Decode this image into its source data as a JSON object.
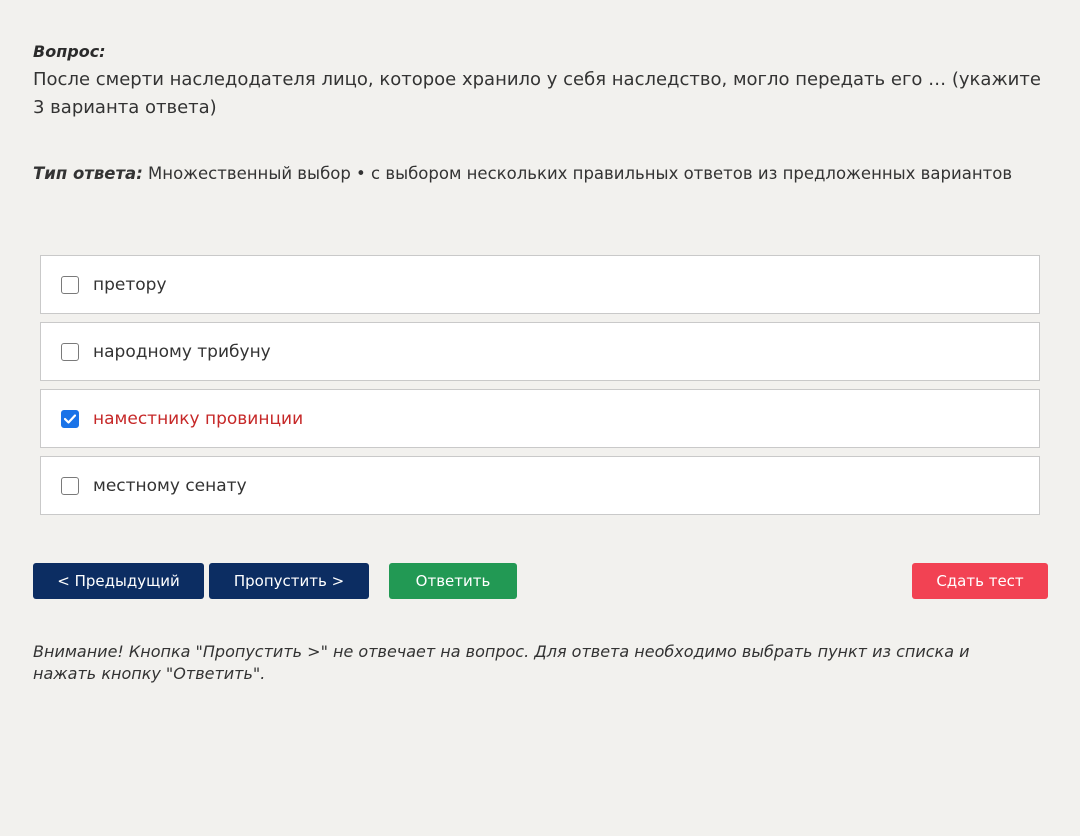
{
  "question": {
    "label": "Вопрос:",
    "text": "После смерти наследодателя лицо, которое хранило у себя наследство, могло передать его … (укажите 3 варианта ответа)"
  },
  "answer_type": {
    "label": "Тип ответа:",
    "value": "Множественный выбор • с выбором нескольких правильных ответов из предложенных вариантов"
  },
  "options": [
    {
      "label": "претору",
      "checked": false
    },
    {
      "label": "народному трибуну",
      "checked": false
    },
    {
      "label": "наместнику провинции",
      "checked": true
    },
    {
      "label": "местному сенату",
      "checked": false
    }
  ],
  "buttons": {
    "prev": "< Предыдущий",
    "skip": "Пропустить >",
    "answer": "Ответить",
    "finish": "Сдать тест"
  },
  "note": "Внимание! Кнопка \"Пропустить >\" не отвечает на вопрос. Для ответа необходимо выбрать пункт из списка и нажать кнопку \"Ответить\".",
  "colors": {
    "background": "#f2f1ee",
    "primary_button": "#0c2d62",
    "answer_button": "#229954",
    "finish_button": "#f24253",
    "selected_text": "#c62828",
    "checkbox_checked": "#1a73e8"
  }
}
